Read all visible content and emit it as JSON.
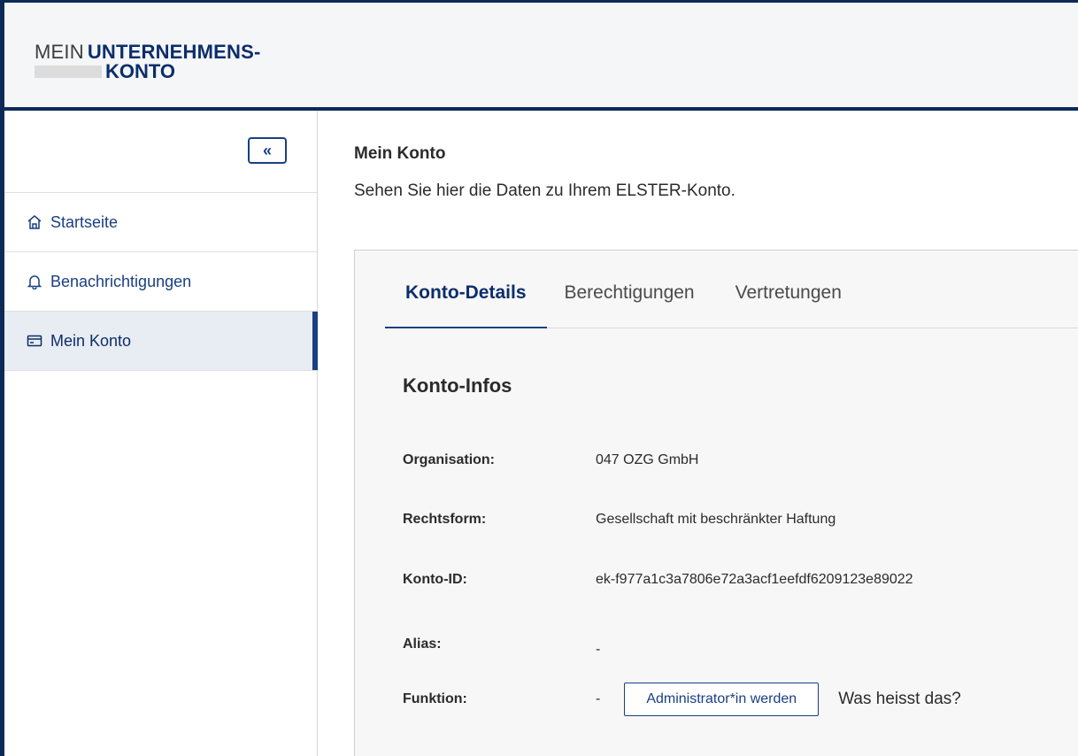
{
  "header": {
    "logo_mein": "MEIN",
    "logo_brand": "UNTERNEHMENS-",
    "logo_konto": "KONTO"
  },
  "sidebar": {
    "collapse_label": "«",
    "items": [
      {
        "label": "Startseite",
        "icon": "home-icon"
      },
      {
        "label": "Benachrichtigungen",
        "icon": "bell-icon"
      },
      {
        "label": "Mein Konto",
        "icon": "card-icon",
        "active": true
      }
    ]
  },
  "main": {
    "title": "Mein Konto",
    "subtitle": "Sehen Sie hier die Daten zu Ihrem ELSTER-Konto.",
    "tabs": [
      {
        "label": "Konto-Details",
        "active": true
      },
      {
        "label": "Berechtigungen"
      },
      {
        "label": "Vertretungen"
      }
    ],
    "section_title": "Konto-Infos",
    "fields": {
      "organisation": {
        "label": "Organisation:",
        "value": "047 OZG GmbH"
      },
      "rechtsform": {
        "label": "Rechtsform:",
        "value": "Gesellschaft mit beschränkter Haftung"
      },
      "konto_id": {
        "label": "Konto-ID:",
        "value": "ek-f977a1c3a7806e72a3acf1eefdf6209123e89022"
      },
      "alias": {
        "label": "Alias:",
        "value": "-"
      },
      "funktion": {
        "label": "Funktion:",
        "value": "-"
      }
    },
    "admin_button": "Administrator*in werden",
    "help_link": "Was heisst das?"
  },
  "colors": {
    "brand": "#0b2e6b",
    "accent": "#1a3f82",
    "active_bg": "#e8ecf3"
  }
}
